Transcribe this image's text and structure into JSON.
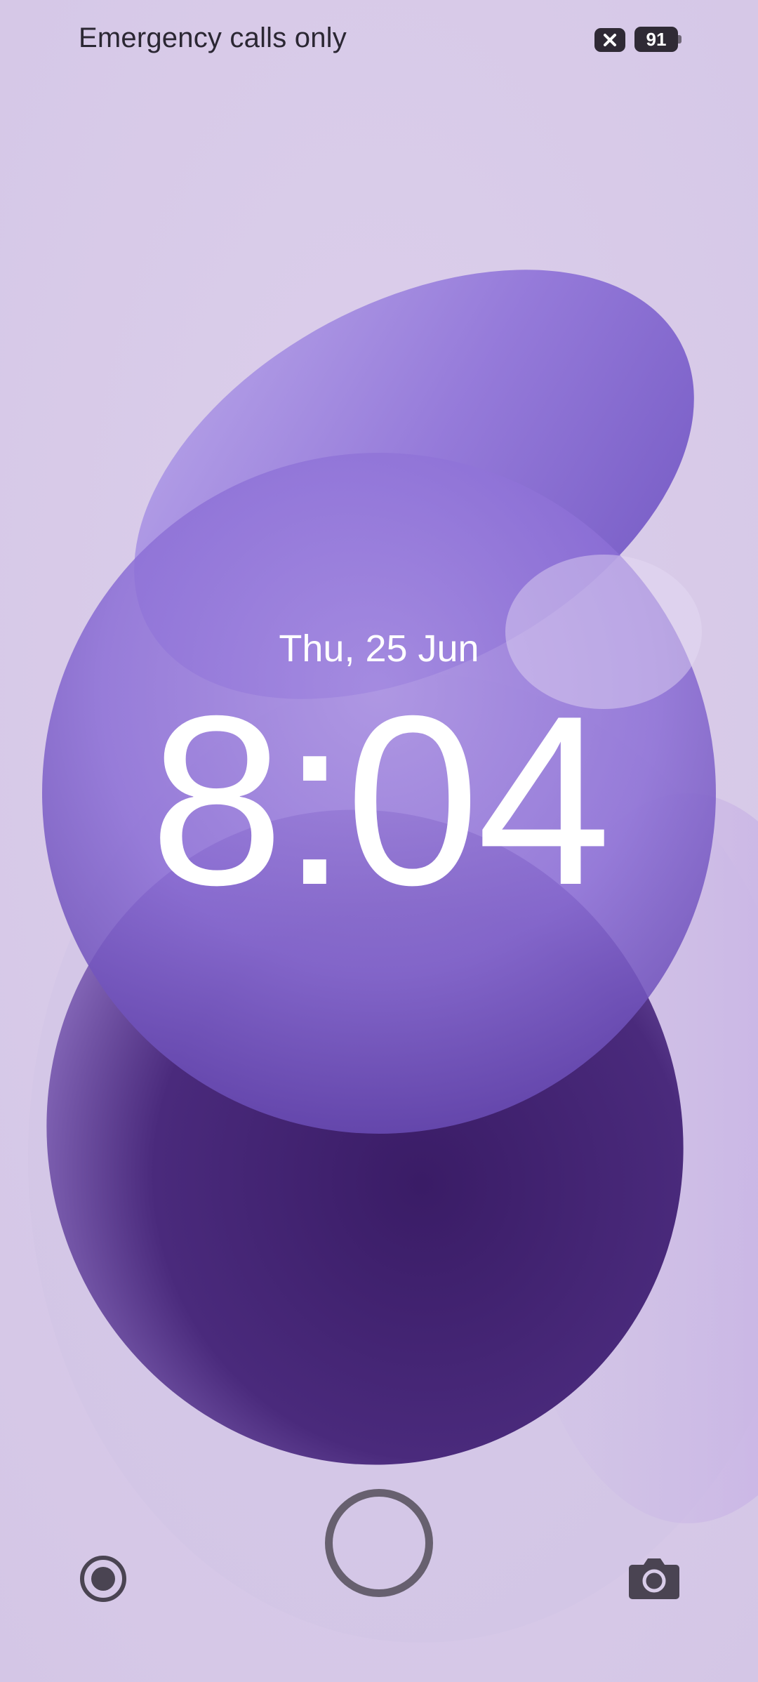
{
  "status_bar": {
    "carrier_text": "Emergency calls only",
    "battery_level": "91",
    "sim_icon": "no-sim-icon"
  },
  "lockscreen": {
    "date": "Thu, 25 Jun",
    "time": "8:04"
  },
  "shortcuts": {
    "left_icon": "record-icon",
    "center_icon": "unlock-ring-icon",
    "right_icon": "camera-icon"
  },
  "colors": {
    "background": "#d9cde9",
    "accent_purple": "#7b5fc8",
    "deep_purple": "#3e2068",
    "status_icon": "#2f2a35",
    "shortcut_icon": "#4a4452"
  }
}
